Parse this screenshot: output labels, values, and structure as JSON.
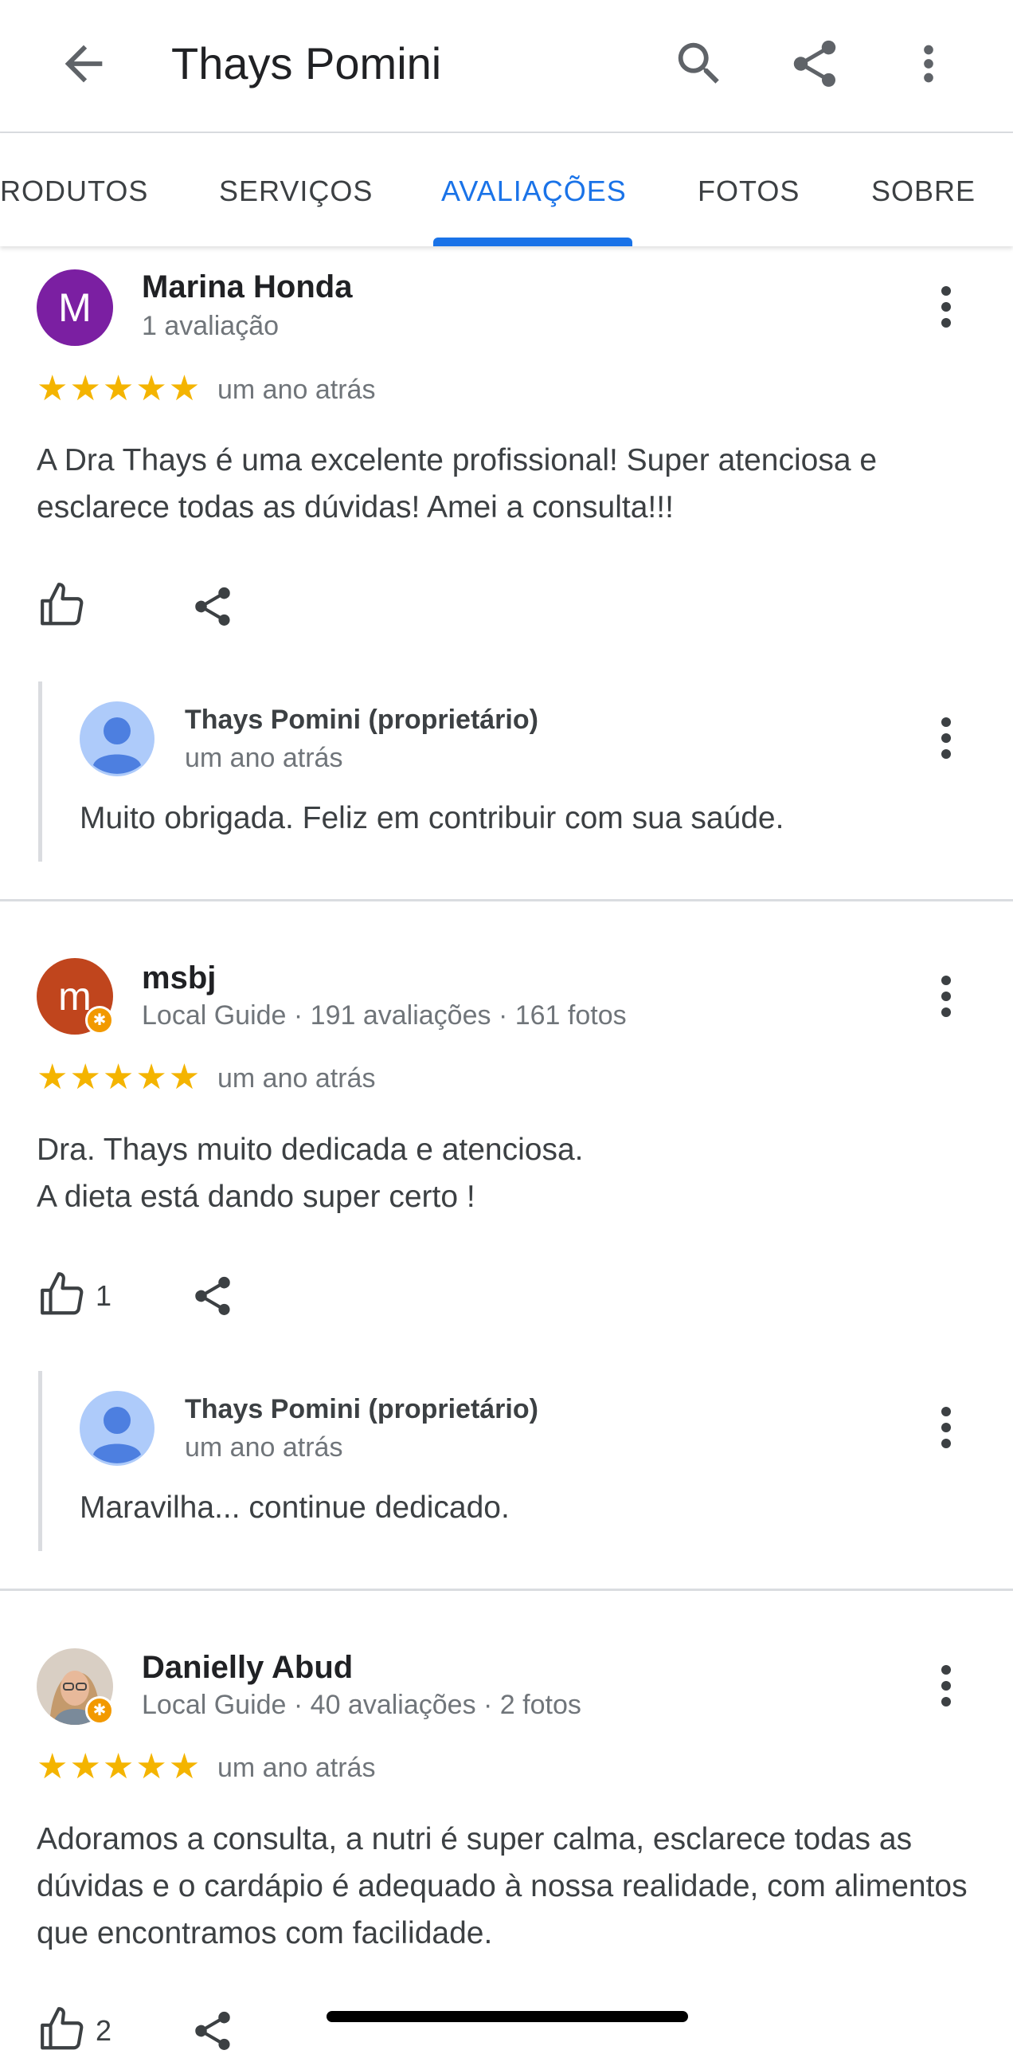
{
  "header": {
    "title": "Thays Pomini",
    "icons": [
      "back-arrow-icon",
      "search-icon",
      "share-icon",
      "more-vert-icon"
    ]
  },
  "tabs": [
    {
      "label": "RODUTOS",
      "active": false
    },
    {
      "label": "SERVIÇOS",
      "active": false
    },
    {
      "label": "AVALIAÇÕES",
      "active": true
    },
    {
      "label": "FOTOS",
      "active": false
    },
    {
      "label": "SOBRE",
      "active": false
    }
  ],
  "colors": {
    "accent": "#1a73e8",
    "star": "#f4b400",
    "local_guide_badge": "#f29900"
  },
  "reviews": [
    {
      "author": "Marina Honda",
      "avatar_letter": "M",
      "avatar_color": "#7b1fa2",
      "meta": "1 avaliação",
      "rating": 5,
      "stars": "★★★★★",
      "date": "um ano atrás",
      "text": "A Dra Thays é uma excelente profissional! Super atenciosa e esclarece todas as dúvidas! Amei a consulta!!!",
      "likes": "",
      "reply": {
        "author": "Thays Pomini (proprietário)",
        "date": "um ano atrás",
        "text": "Muito obrigada. Feliz em contribuir com sua saúde."
      }
    },
    {
      "author": "msbj",
      "avatar_letter": "m",
      "avatar_color": "#c0451d",
      "meta": "Local Guide · 191 avaliações · 161 fotos",
      "rating": 5,
      "stars": "★★★★★",
      "date": "um ano atrás",
      "text_lines": [
        "Dra. Thays muito dedicada e atenciosa.",
        "A dieta está dando super certo !"
      ],
      "likes": "1",
      "reply": {
        "author": "Thays Pomini (proprietário)",
        "date": "um ano atrás",
        "text": "Maravilha... continue dedicado."
      }
    },
    {
      "author": "Danielly Abud",
      "avatar_photo": true,
      "meta": "Local Guide · 40 avaliações · 2 fotos",
      "rating": 5,
      "stars": "★★★★★",
      "date": "um ano atrás",
      "text": "Adoramos a consulta, a nutri é super calma, esclarece todas as dúvidas e o cardápio é adequado à nossa realidade, com alimentos que encontramos com facilidade.",
      "likes": "2"
    }
  ]
}
